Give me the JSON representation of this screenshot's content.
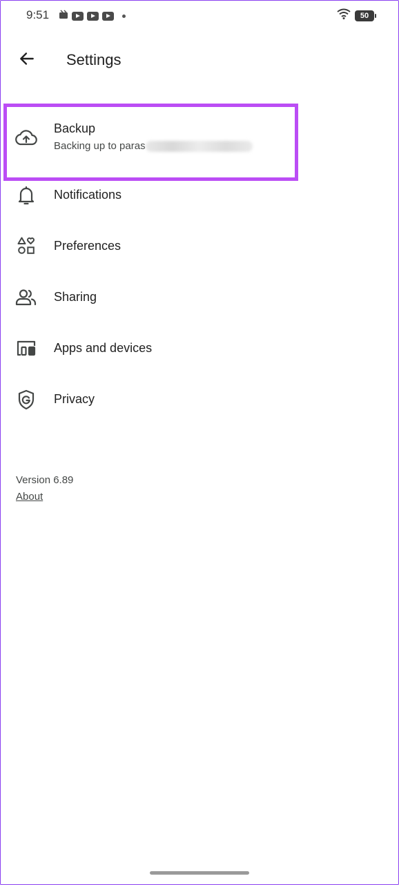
{
  "status_bar": {
    "time": "9:51",
    "battery": "50",
    "icons": [
      "media-icon",
      "youtube-icon",
      "youtube-icon",
      "youtube-icon",
      "dot-icon",
      "wifi-icon",
      "battery-icon"
    ]
  },
  "header": {
    "title": "Settings",
    "back_icon": "arrow-back-icon"
  },
  "menu": {
    "items": [
      {
        "label": "Backup",
        "subtitle": "Backing up to paras",
        "icon": "cloud-upload-icon"
      },
      {
        "label": "Notifications",
        "icon": "bell-icon"
      },
      {
        "label": "Preferences",
        "icon": "shapes-icon"
      },
      {
        "label": "Sharing",
        "icon": "people-icon"
      },
      {
        "label": "Apps and devices",
        "icon": "devices-icon"
      },
      {
        "label": "Privacy",
        "icon": "shield-g-icon"
      }
    ]
  },
  "footer": {
    "version": "Version 6.89",
    "about": "About"
  },
  "colors": {
    "highlight": "#bb4df5",
    "text": "#1f1f1f",
    "secondary_text": "#444746"
  }
}
